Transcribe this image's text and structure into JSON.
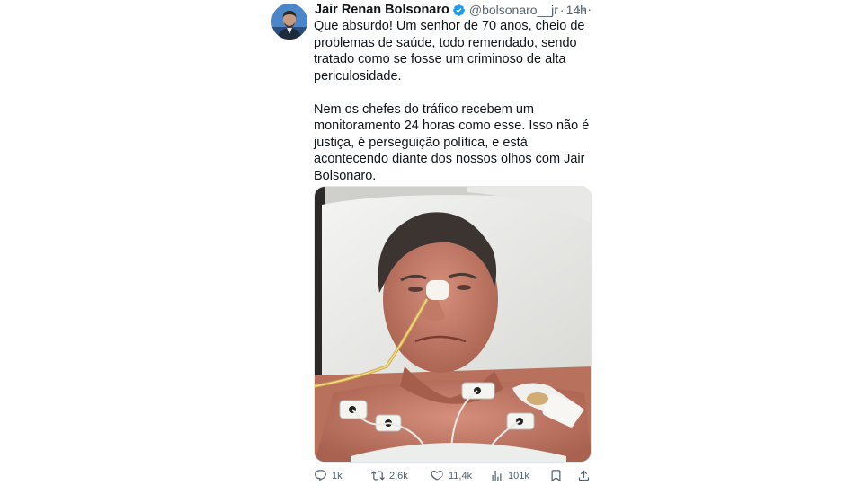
{
  "tweet": {
    "author_name": "Jair Renan Bolsonaro",
    "handle": "@bolsonaro__jr",
    "separator": "·",
    "time": "14h",
    "more_label": "···",
    "paragraphs": [
      "Que absurdo! Um senhor de 70 anos, cheio de problemas de saúde, todo remendado, sendo tratado como se fosse um criminoso de alta periculosidade.",
      "Nem os chefes do tráfico recebem um monitoramento 24 horas como esse. Isso não é justiça, é perseguição política, e está acontecendo diante dos nossos olhos com Jair Bolsonaro."
    ],
    "verified": true
  },
  "actions": {
    "replies": "1k",
    "reposts": "2,6k",
    "likes": "11,4k",
    "views": "101k"
  },
  "colors": {
    "text": "#0f1419",
    "secondary": "#536471",
    "verified_blue": "#1d9bf0"
  },
  "icons": [
    "verified-badge-icon",
    "more-icon",
    "reply-icon",
    "repost-icon",
    "like-icon",
    "views-icon",
    "bookmark-icon",
    "share-icon"
  ]
}
